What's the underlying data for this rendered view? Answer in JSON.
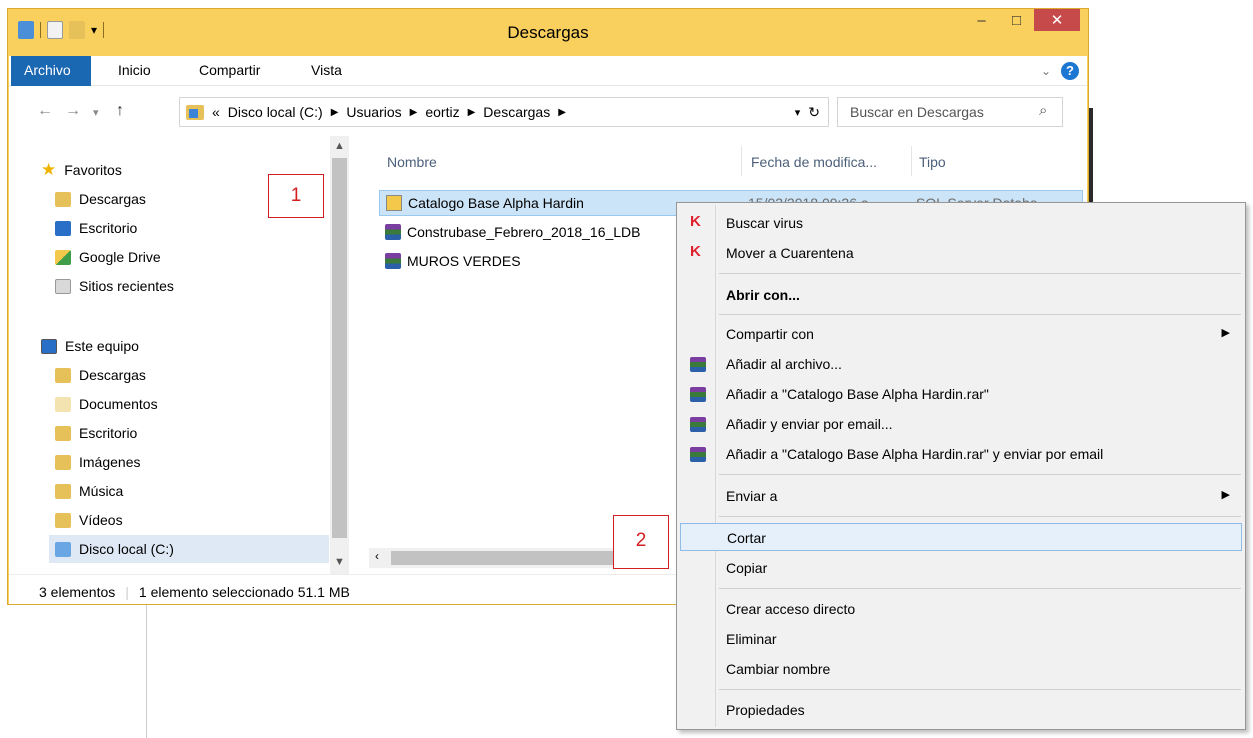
{
  "window": {
    "title": "Descargas",
    "minimize": "–",
    "maximize": "□",
    "close": "✕"
  },
  "ribbon": {
    "tabs": [
      "Archivo",
      "Inicio",
      "Compartir",
      "Vista"
    ]
  },
  "address": {
    "overflow": "«",
    "segments": [
      "Disco local (C:)",
      "Usuarios",
      "eortiz",
      "Descargas"
    ],
    "refresh": "↻"
  },
  "search": {
    "placeholder": "Buscar en Descargas"
  },
  "nav": {
    "favorites_header": "Favoritos",
    "favorites": [
      "Descargas",
      "Escritorio",
      "Google Drive",
      "Sitios recientes"
    ],
    "pc_header": "Este equipo",
    "pc_items": [
      "Descargas",
      "Documentos",
      "Escritorio",
      "Imágenes",
      "Música",
      "Vídeos",
      "Disco local (C:)"
    ]
  },
  "columns": [
    "Nombre",
    "Fecha de modifica...",
    "Tipo"
  ],
  "files": [
    {
      "name": "Catalogo Base Alpha Hardin",
      "date": "15/02/2018 09:26 a...",
      "type": "SQL Server Databa...",
      "selected": true
    },
    {
      "name": "Construbase_Febrero_2018_16_LDB",
      "date": "",
      "type": ""
    },
    {
      "name": "MUROS VERDES",
      "date": "",
      "type": ""
    }
  ],
  "status": {
    "count": "3 elementos",
    "selection": "1 elemento seleccionado  51.1 MB"
  },
  "callouts": [
    "1",
    "2"
  ],
  "context_menu": {
    "items": [
      "Buscar virus",
      "Mover a Cuarentena",
      "Abrir con...",
      "Compartir con",
      "Añadir al archivo...",
      "Añadir a \"Catalogo Base Alpha Hardin.rar\"",
      "Añadir y enviar por email...",
      "Añadir a \"Catalogo Base Alpha Hardin.rar\" y enviar por email",
      "Enviar a",
      "Cortar",
      "Copiar",
      "Crear acceso directo",
      "Eliminar",
      "Cambiar nombre",
      "Propiedades"
    ]
  }
}
